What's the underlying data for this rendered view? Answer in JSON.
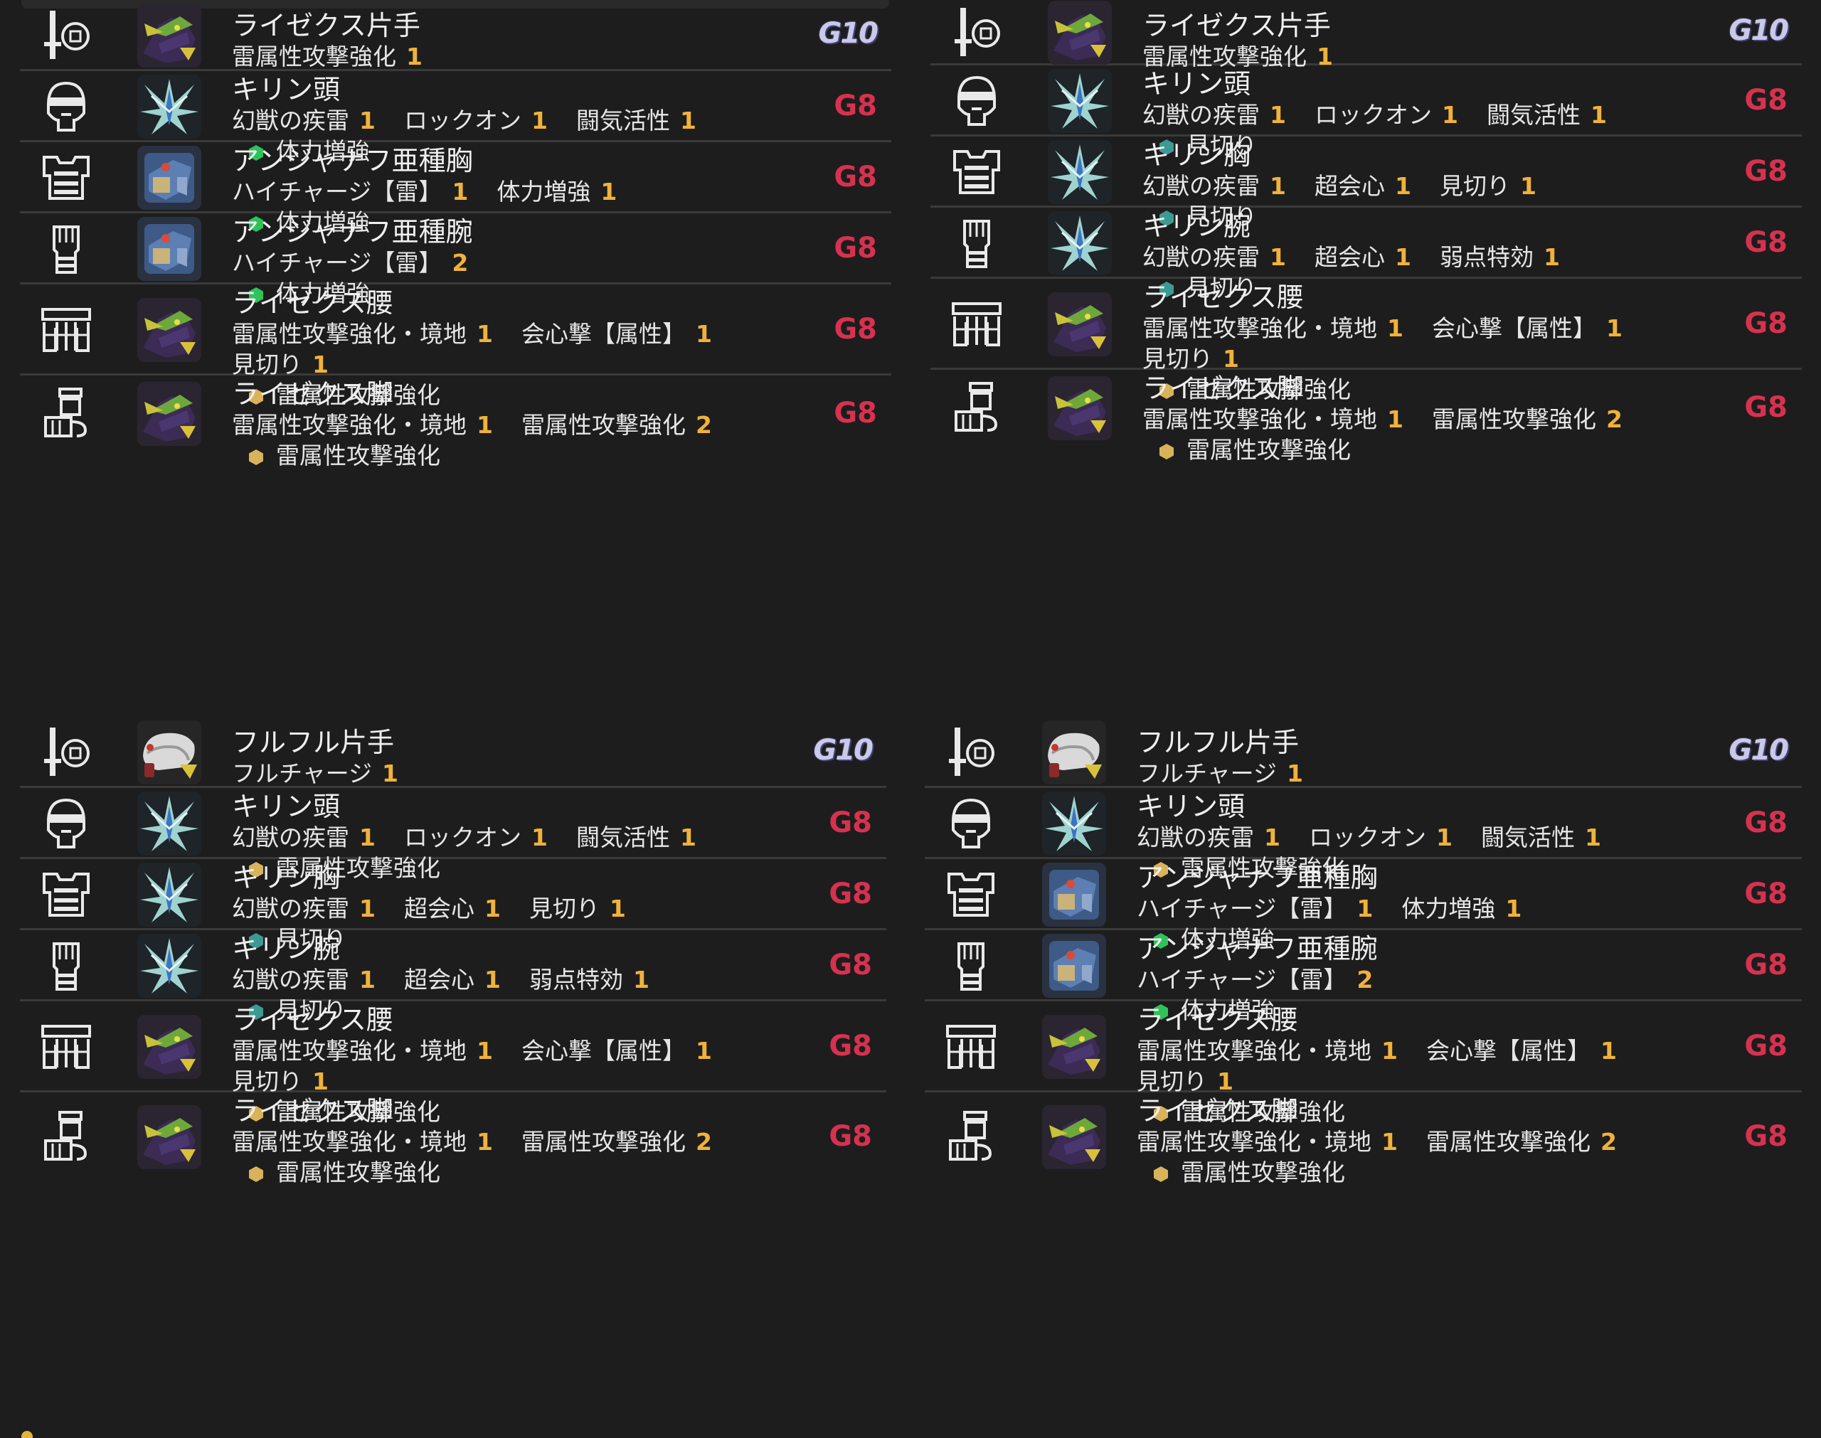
{
  "sets": [
    {
      "id": "set-a",
      "rows": [
        {
          "slot": "weapon",
          "thumb": "raizex",
          "name": "ライゼクス片手",
          "skills": [
            {
              "n": "雷属性攻撃強化",
              "l": "1"
            }
          ],
          "deco": null,
          "decoColor": null,
          "rank": "G10"
        },
        {
          "slot": "head",
          "thumb": "kirin",
          "name": "キリン頭",
          "skills": [
            {
              "n": "幻獣の疾雷",
              "l": "1"
            },
            {
              "n": "ロックオン",
              "l": "1"
            },
            {
              "n": "闘気活性",
              "l": "1"
            }
          ],
          "deco": "体力増強",
          "decoColor": "green",
          "rank": "G8"
        },
        {
          "slot": "chest",
          "thumb": "anja",
          "name": "アンジャナフ亜種胸",
          "skills": [
            {
              "n": "ハイチャージ【雷】",
              "l": "1"
            },
            {
              "n": "体力増強",
              "l": "1"
            }
          ],
          "deco": "体力増強",
          "decoColor": "green",
          "rank": "G8"
        },
        {
          "slot": "arms",
          "thumb": "anja",
          "name": "アンジャナフ亜種腕",
          "skills": [
            {
              "n": "ハイチャージ【雷】",
              "l": "2"
            }
          ],
          "deco": "体力増強",
          "decoColor": "green",
          "rank": "G8"
        },
        {
          "slot": "waist",
          "thumb": "raizex",
          "name": "ライゼクス腰",
          "skills": [
            {
              "n": "雷属性攻撃強化・境地",
              "l": "1"
            },
            {
              "n": "会心撃【属性】",
              "l": "1"
            }
          ],
          "skills2": [
            {
              "n": "見切り",
              "l": "1"
            }
          ],
          "deco": "雷属性攻撃強化",
          "decoColor": "yellow",
          "rank": "G8"
        },
        {
          "slot": "legs",
          "thumb": "raizex",
          "name": "ライゼクス脚",
          "skills": [
            {
              "n": "雷属性攻撃強化・境地",
              "l": "1"
            },
            {
              "n": "雷属性攻撃強化",
              "l": "2"
            }
          ],
          "deco": "雷属性攻撃強化",
          "decoColor": "yellow",
          "rank": "G8"
        }
      ]
    },
    {
      "id": "set-b",
      "rows": [
        {
          "slot": "weapon",
          "thumb": "raizex",
          "name": "ライゼクス片手",
          "skills": [
            {
              "n": "雷属性攻撃強化",
              "l": "1"
            }
          ],
          "deco": null,
          "decoColor": null,
          "rank": "G10"
        },
        {
          "slot": "head",
          "thumb": "kirin",
          "name": "キリン頭",
          "skills": [
            {
              "n": "幻獣の疾雷",
              "l": "1"
            },
            {
              "n": "ロックオン",
              "l": "1"
            },
            {
              "n": "闘気活性",
              "l": "1"
            }
          ],
          "deco": "見切り",
          "decoColor": "teal",
          "rank": "G8"
        },
        {
          "slot": "chest",
          "thumb": "kirin",
          "name": "キリン胸",
          "skills": [
            {
              "n": "幻獣の疾雷",
              "l": "1"
            },
            {
              "n": "超会心",
              "l": "1"
            },
            {
              "n": "見切り",
              "l": "1"
            }
          ],
          "deco": "見切り",
          "decoColor": "teal",
          "rank": "G8"
        },
        {
          "slot": "arms",
          "thumb": "kirin",
          "name": "キリン腕",
          "skills": [
            {
              "n": "幻獣の疾雷",
              "l": "1"
            },
            {
              "n": "超会心",
              "l": "1"
            },
            {
              "n": "弱点特効",
              "l": "1"
            }
          ],
          "deco": "見切り",
          "decoColor": "teal",
          "rank": "G8"
        },
        {
          "slot": "waist",
          "thumb": "raizex",
          "name": "ライゼクス腰",
          "skills": [
            {
              "n": "雷属性攻撃強化・境地",
              "l": "1"
            },
            {
              "n": "会心撃【属性】",
              "l": "1"
            }
          ],
          "skills2": [
            {
              "n": "見切り",
              "l": "1"
            }
          ],
          "deco": "雷属性攻撃強化",
          "decoColor": "yellow",
          "rank": "G8"
        },
        {
          "slot": "legs",
          "thumb": "raizex",
          "name": "ライゼクス脚",
          "skills": [
            {
              "n": "雷属性攻撃強化・境地",
              "l": "1"
            },
            {
              "n": "雷属性攻撃強化",
              "l": "2"
            }
          ],
          "deco": "雷属性攻撃強化",
          "decoColor": "yellow",
          "rank": "G8"
        }
      ]
    },
    {
      "id": "set-c",
      "rows": [
        {
          "slot": "weapon",
          "thumb": "khezu",
          "name": "フルフル片手",
          "skills": [
            {
              "n": "フルチャージ",
              "l": "1"
            }
          ],
          "deco": null,
          "decoColor": null,
          "rank": "G10"
        },
        {
          "slot": "head",
          "thumb": "kirin",
          "name": "キリン頭",
          "skills": [
            {
              "n": "幻獣の疾雷",
              "l": "1"
            },
            {
              "n": "ロックオン",
              "l": "1"
            },
            {
              "n": "闘気活性",
              "l": "1"
            }
          ],
          "deco": "雷属性攻撃強化",
          "decoColor": "yellow",
          "rank": "G8"
        },
        {
          "slot": "chest",
          "thumb": "kirin",
          "name": "キリン胸",
          "skills": [
            {
              "n": "幻獣の疾雷",
              "l": "1"
            },
            {
              "n": "超会心",
              "l": "1"
            },
            {
              "n": "見切り",
              "l": "1"
            }
          ],
          "deco": "見切り",
          "decoColor": "teal",
          "rank": "G8"
        },
        {
          "slot": "arms",
          "thumb": "kirin",
          "name": "キリン腕",
          "skills": [
            {
              "n": "幻獣の疾雷",
              "l": "1"
            },
            {
              "n": "超会心",
              "l": "1"
            },
            {
              "n": "弱点特効",
              "l": "1"
            }
          ],
          "deco": "見切り",
          "decoColor": "teal",
          "rank": "G8"
        },
        {
          "slot": "waist",
          "thumb": "raizex",
          "name": "ライゼクス腰",
          "skills": [
            {
              "n": "雷属性攻撃強化・境地",
              "l": "1"
            },
            {
              "n": "会心撃【属性】",
              "l": "1"
            }
          ],
          "skills2": [
            {
              "n": "見切り",
              "l": "1"
            }
          ],
          "deco": "雷属性攻撃強化",
          "decoColor": "yellow",
          "rank": "G8"
        },
        {
          "slot": "legs",
          "thumb": "raizex",
          "name": "ライゼクス脚",
          "skills": [
            {
              "n": "雷属性攻撃強化・境地",
              "l": "1"
            },
            {
              "n": "雷属性攻撃強化",
              "l": "2"
            }
          ],
          "deco": "雷属性攻撃強化",
          "decoColor": "yellow",
          "rank": "G8"
        }
      ]
    },
    {
      "id": "set-d",
      "rows": [
        {
          "slot": "weapon",
          "thumb": "khezu",
          "name": "フルフル片手",
          "skills": [
            {
              "n": "フルチャージ",
              "l": "1"
            }
          ],
          "deco": null,
          "decoColor": null,
          "rank": "G10"
        },
        {
          "slot": "head",
          "thumb": "kirin",
          "name": "キリン頭",
          "skills": [
            {
              "n": "幻獣の疾雷",
              "l": "1"
            },
            {
              "n": "ロックオン",
              "l": "1"
            },
            {
              "n": "闘気活性",
              "l": "1"
            }
          ],
          "deco": "雷属性攻撃強化",
          "decoColor": "yellow",
          "rank": "G8"
        },
        {
          "slot": "chest",
          "thumb": "anja",
          "name": "アンジャナフ亜種胸",
          "skills": [
            {
              "n": "ハイチャージ【雷】",
              "l": "1"
            },
            {
              "n": "体力増強",
              "l": "1"
            }
          ],
          "deco": "体力増強",
          "decoColor": "green",
          "rank": "G8"
        },
        {
          "slot": "arms",
          "thumb": "anja",
          "name": "アンジャナフ亜種腕",
          "skills": [
            {
              "n": "ハイチャージ【雷】",
              "l": "2"
            }
          ],
          "deco": "体力増強",
          "decoColor": "green",
          "rank": "G8"
        },
        {
          "slot": "waist",
          "thumb": "raizex",
          "name": "ライゼクス腰",
          "skills": [
            {
              "n": "雷属性攻撃強化・境地",
              "l": "1"
            },
            {
              "n": "会心撃【属性】",
              "l": "1"
            }
          ],
          "skills2": [
            {
              "n": "見切り",
              "l": "1"
            }
          ],
          "deco": "雷属性攻撃強化",
          "decoColor": "yellow",
          "rank": "G8"
        },
        {
          "slot": "legs",
          "thumb": "raizex",
          "name": "ライゼクス脚",
          "skills": [
            {
              "n": "雷属性攻撃強化・境地",
              "l": "1"
            },
            {
              "n": "雷属性攻撃強化",
              "l": "2"
            }
          ],
          "deco": "雷属性攻撃強化",
          "decoColor": "yellow",
          "rank": "G8"
        }
      ]
    }
  ],
  "colors": {
    "rank_g8": "#d6324f",
    "level": "#f0b23c",
    "deco_green": "#2fc25a",
    "deco_teal": "#3d9a93",
    "deco_yellow": "#d9b35a"
  },
  "icons": {
    "weapon": "sword-shield-icon",
    "head": "helmet-icon",
    "chest": "chest-armor-icon",
    "arms": "gauntlet-icon",
    "waist": "waist-armor-icon",
    "legs": "greaves-icon"
  }
}
